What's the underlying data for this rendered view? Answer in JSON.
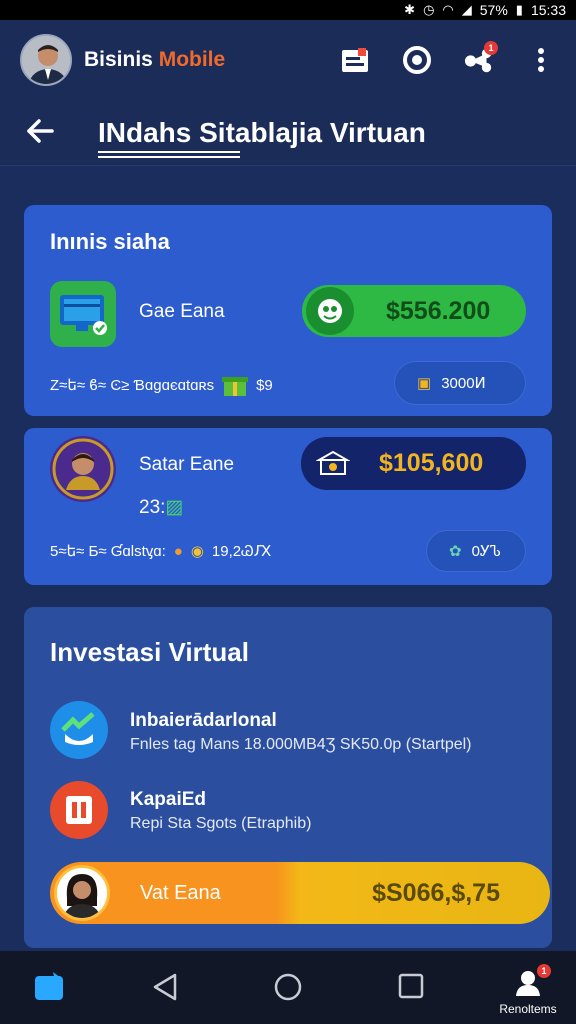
{
  "status_bar": {
    "battery": "57%",
    "time": "15:33"
  },
  "app_bar": {
    "brand_primary": "Bisinis ",
    "brand_accent": "Mobile",
    "notification_count": "1"
  },
  "page": {
    "title": "INdahs Sitablajia Virtuan"
  },
  "business_card": {
    "title": "Inınis siaha",
    "item1": {
      "name": "Gae Eana",
      "amount": "$556.200",
      "meta_text": "Z≈ե≈ ϐ≈ Ͼ≥ Ɓɑgɑєɑtɑʀs",
      "meta_value": "$9",
      "chip_value": "3000Ͷ"
    },
    "item2": {
      "name": "Satar Eane",
      "sub": "23:",
      "amount": "$105,600",
      "meta_text": "5≈ե≈ Ƃ≈ Ɠɑlѕtᶌɑ:",
      "meta_value": "19,2ᏊԔ",
      "chip_value": "0ᎩᏖ"
    }
  },
  "invest_card": {
    "title": "Investasi Virtual",
    "row1": {
      "title": "Inbaierādarlonal",
      "sub": "Fnles tag Mans 18.000ΜΒ4Ʒ SΚ50.0p (Startpel)"
    },
    "row2": {
      "title": "KapaiEd",
      "sub": "Repi Sta Sgots (Etraphib)"
    },
    "highlight": {
      "label": "Vat Eana",
      "amount": "$S066,$,75"
    }
  },
  "nav_bar": {
    "profile_label": "Renoltems",
    "profile_badge": "1"
  },
  "colors": {
    "accent": "#ef6a2b",
    "green": "#2eb844",
    "gold": "#f2b51f",
    "card_blue": "#2d5ccf"
  }
}
